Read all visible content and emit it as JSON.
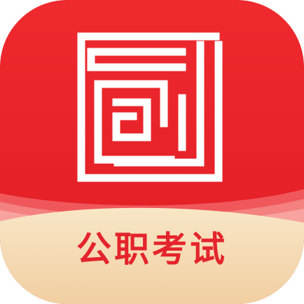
{
  "app_icon": {
    "caption": "公职考试",
    "colors": {
      "primary_red": "#e4242c",
      "dark_red": "#d8141c",
      "wave_pink": "#f27d7d",
      "cream_bottom": "#f7dcb8",
      "logo_white": "#ffffff"
    },
    "logo": "maze-square-logo"
  }
}
